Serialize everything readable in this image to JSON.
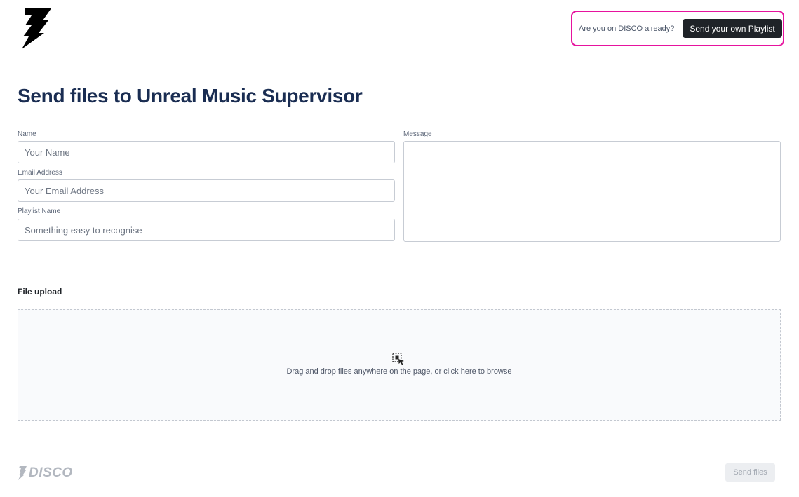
{
  "header": {
    "prompt": "Are you on DISCO already?",
    "cta_label": "Send your own Playlist"
  },
  "page": {
    "title": "Send files to Unreal Music Supervisor"
  },
  "form": {
    "name": {
      "label": "Name",
      "placeholder": "Your Name",
      "value": ""
    },
    "email": {
      "label": "Email Address",
      "placeholder": "Your Email Address",
      "value": ""
    },
    "playlist": {
      "label": "Playlist Name",
      "placeholder": "Something easy to recognise",
      "value": ""
    },
    "message": {
      "label": "Message",
      "value": ""
    }
  },
  "upload": {
    "title": "File upload",
    "instructions": "Drag and drop files anywhere on the page, or click here to browse",
    "icon": "drop-target-icon"
  },
  "footer": {
    "brand": "DISCO",
    "send_label": "Send files",
    "send_enabled": false
  },
  "colors": {
    "title": "#1a2d52",
    "cta_background": "#1f2328",
    "highlight_border": "#e6139e",
    "disabled_button": "#eceef1"
  }
}
